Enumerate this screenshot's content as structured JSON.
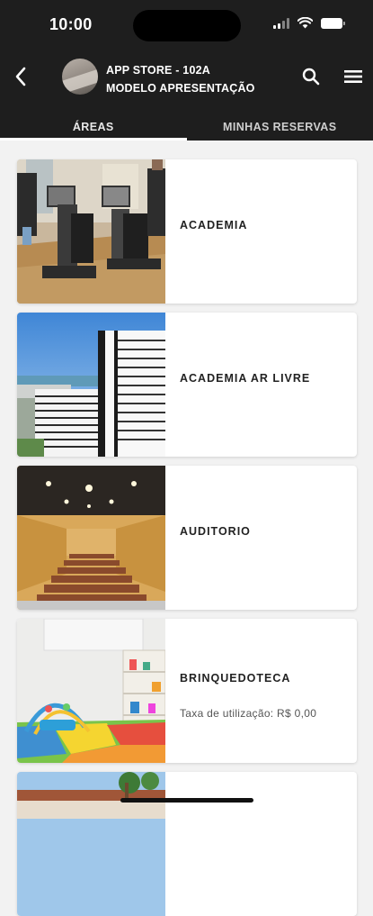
{
  "status_bar": {
    "time": "10:00",
    "icons": [
      "signal-icon",
      "wifi-icon",
      "battery-icon"
    ]
  },
  "header": {
    "title": "APP STORE - 102A",
    "subtitle": "MODELO APRESENTAÇÃO",
    "icons": [
      "back-arrow-icon",
      "search-icon",
      "menu-icon"
    ]
  },
  "tabs": [
    {
      "label": "ÁREAS",
      "active": true
    },
    {
      "label": "MINHAS RESERVAS",
      "active": false
    }
  ],
  "areas": [
    {
      "name": "ACADEMIA",
      "image": "gym-equipment-photo"
    },
    {
      "name": "ACADEMIA AR LIVRE",
      "image": "city-buildings-photo"
    },
    {
      "name": "AUDITORIO",
      "image": "auditorium-photo"
    },
    {
      "name": "BRINQUEDOTECA",
      "fee": "Taxa de utilização: R$ 0,00",
      "image": "playroom-photo"
    },
    {
      "name": "",
      "image": "building-exterior-photo"
    }
  ],
  "colors": {
    "header_bg": "#1e1e1e",
    "page_bg": "#f2f2f2",
    "card_bg": "#ffffff",
    "text": "#222222"
  }
}
